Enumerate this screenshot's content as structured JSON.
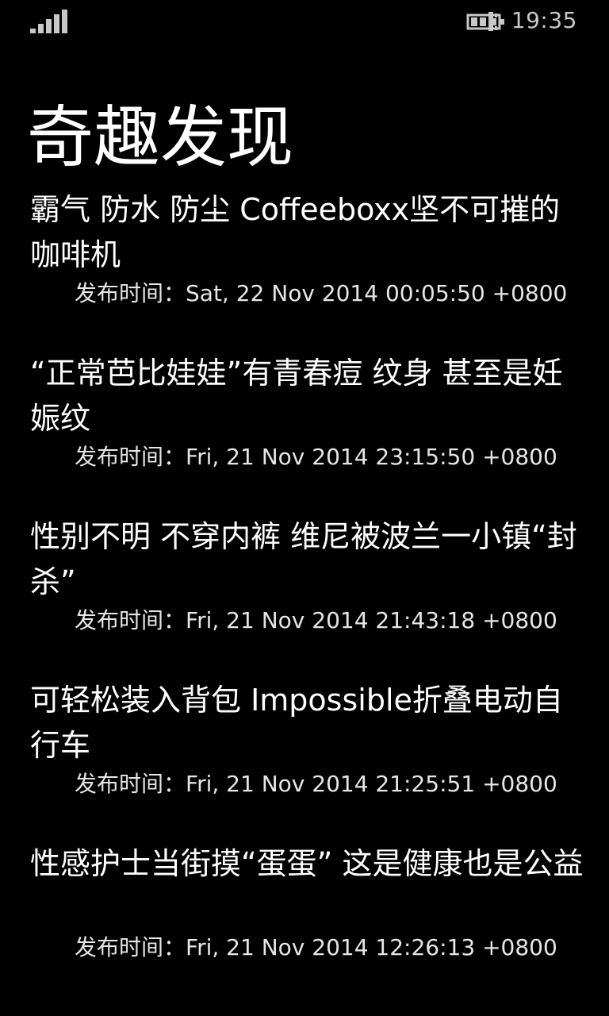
{
  "status_bar": {
    "time": "19:35",
    "signal_icon": "signal-strength-icon",
    "battery_icon": "battery-charging-icon"
  },
  "page": {
    "title": "奇趣发现"
  },
  "articles": [
    {
      "title": "霸气 防水 防尘 Coffeeboxx坚不可摧的咖啡机",
      "date_label": "发布时间：",
      "date": "Sat, 22 Nov 2014 00:05:50 +0800"
    },
    {
      "title": "“正常芭比娃娃”有青春痘 纹身 甚至是妊娠纹",
      "date_label": "发布时间：",
      "date": "Fri, 21 Nov 2014 23:15:50 +0800"
    },
    {
      "title": "性别不明 不穿内裤 维尼被波兰一小镇“封杀”",
      "date_label": "发布时间：",
      "date": "Fri, 21 Nov 2014 21:43:18 +0800"
    },
    {
      "title": "可轻松装入背包 Impossible折叠电动自行车",
      "date_label": "发布时间：",
      "date": "Fri, 21 Nov 2014 21:25:51 +0800"
    },
    {
      "title": "性感护士当街摸“蛋蛋” 这是健康也是公益",
      "date_label": "发布时间：",
      "date": "Fri, 21 Nov 2014 12:26:13 +0800"
    }
  ]
}
